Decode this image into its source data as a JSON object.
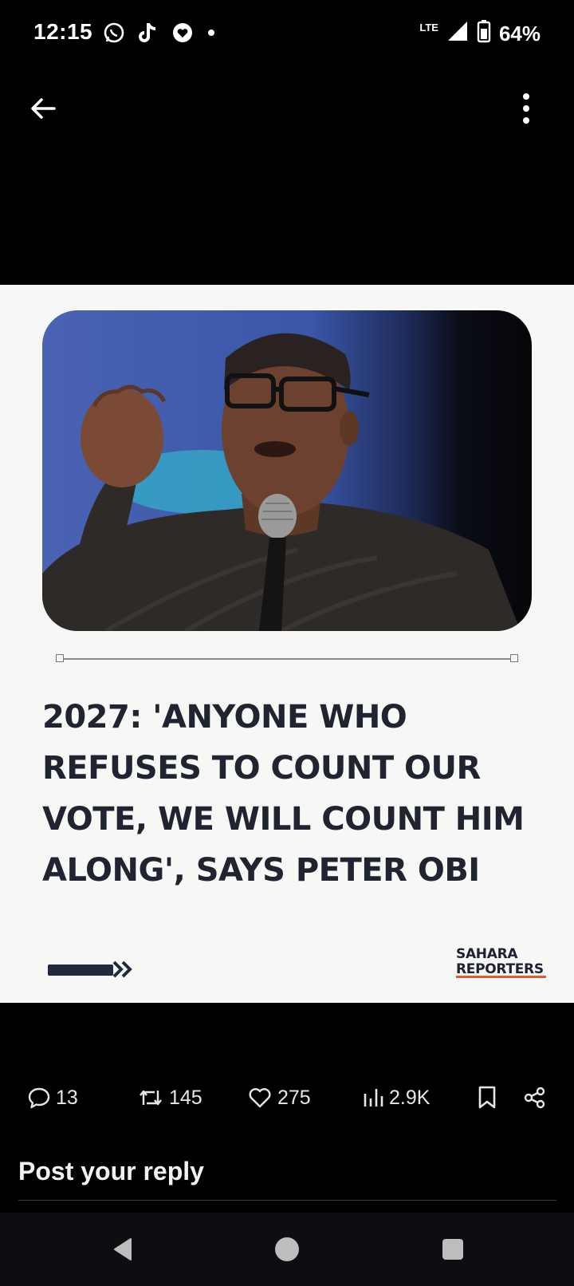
{
  "status_bar": {
    "time": "12:15",
    "network": "LTE",
    "battery": "64%",
    "icons": [
      "whatsapp-icon",
      "tiktok-icon",
      "heart-app-icon",
      "dot-icon",
      "signal-icon",
      "battery-icon"
    ]
  },
  "post": {
    "headline_lines": [
      "2027: 'ANYONE WHO",
      "REFUSES TO COUNT OUR",
      "VOTE, WE WILL COUNT HIM",
      "ALONG', SAYS PETER OBI"
    ],
    "brand_line1": "SAHARA",
    "brand_line2": "REPORTERS",
    "colors": {
      "headline": "#1f2430",
      "brand_accent": "#e3582a"
    }
  },
  "actions": {
    "replies": "13",
    "reposts": "145",
    "likes": "275",
    "views": "2.9K"
  },
  "reply": {
    "label": "Post your reply"
  }
}
